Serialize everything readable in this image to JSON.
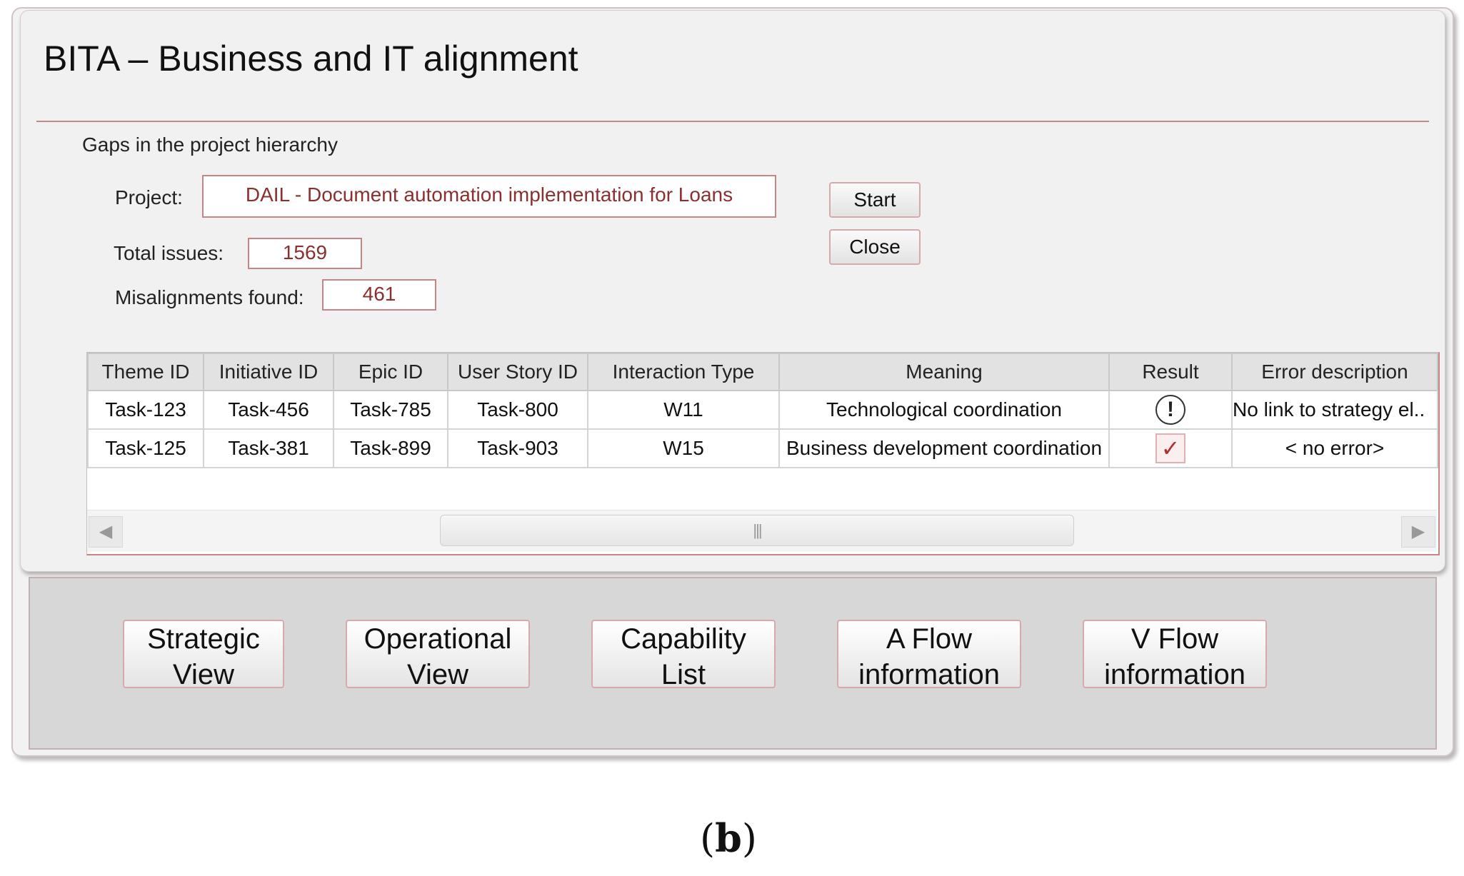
{
  "window": {
    "title": "BITA – Business and IT alignment"
  },
  "section": {
    "title": "Gaps in the project hierarchy"
  },
  "form": {
    "project_label": "Project:",
    "project_value": "DAIL - Document automation implementation for Loans",
    "total_issues_label": "Total issues:",
    "total_issues_value": "1569",
    "misalignments_label": "Misalignments found:",
    "misalignments_value": "461"
  },
  "buttons": {
    "start": "Start",
    "close": "Close"
  },
  "grid": {
    "columns": [
      "Theme ID",
      "Initiative ID",
      "Epic ID",
      "User Story ID",
      "Interaction Type",
      "Meaning",
      "Result",
      "Error description"
    ],
    "rows": [
      {
        "theme_id": "Task-123",
        "initiative_id": "Task-456",
        "epic_id": "Task-785",
        "user_story_id": "Task-800",
        "interaction_type": "W11",
        "meaning": "Technological coordination",
        "result_icon": "warning-icon",
        "result_glyph": "!",
        "error_description": "No link to strategy el.."
      },
      {
        "theme_id": "Task-125",
        "initiative_id": "Task-381",
        "epic_id": "Task-899",
        "user_story_id": "Task-903",
        "interaction_type": "W15",
        "meaning": "Business development coordination",
        "result_icon": "checkmark-icon",
        "result_glyph": "✓",
        "error_description": "< no error>"
      }
    ],
    "scroll_left_glyph": "◀",
    "scroll_right_glyph": "▶",
    "scroll_thumb_glyph": "|||"
  },
  "nav": {
    "strategic_line1": "Strategic",
    "strategic_line2": "View",
    "operational_line1": "Operational",
    "operational_line2": "View",
    "capability_line1": "Capability",
    "capability_line2": "List",
    "aflow_line1": "A Flow",
    "aflow_line2": "information",
    "vflow_line1": "V Flow",
    "vflow_line2": "information"
  },
  "caption": {
    "open": "(",
    "letter": "b",
    "close": ")"
  },
  "colors": {
    "accent_border": "#c98585",
    "value_text": "#8b2f2f",
    "nav_background": "#d7d7d7"
  }
}
